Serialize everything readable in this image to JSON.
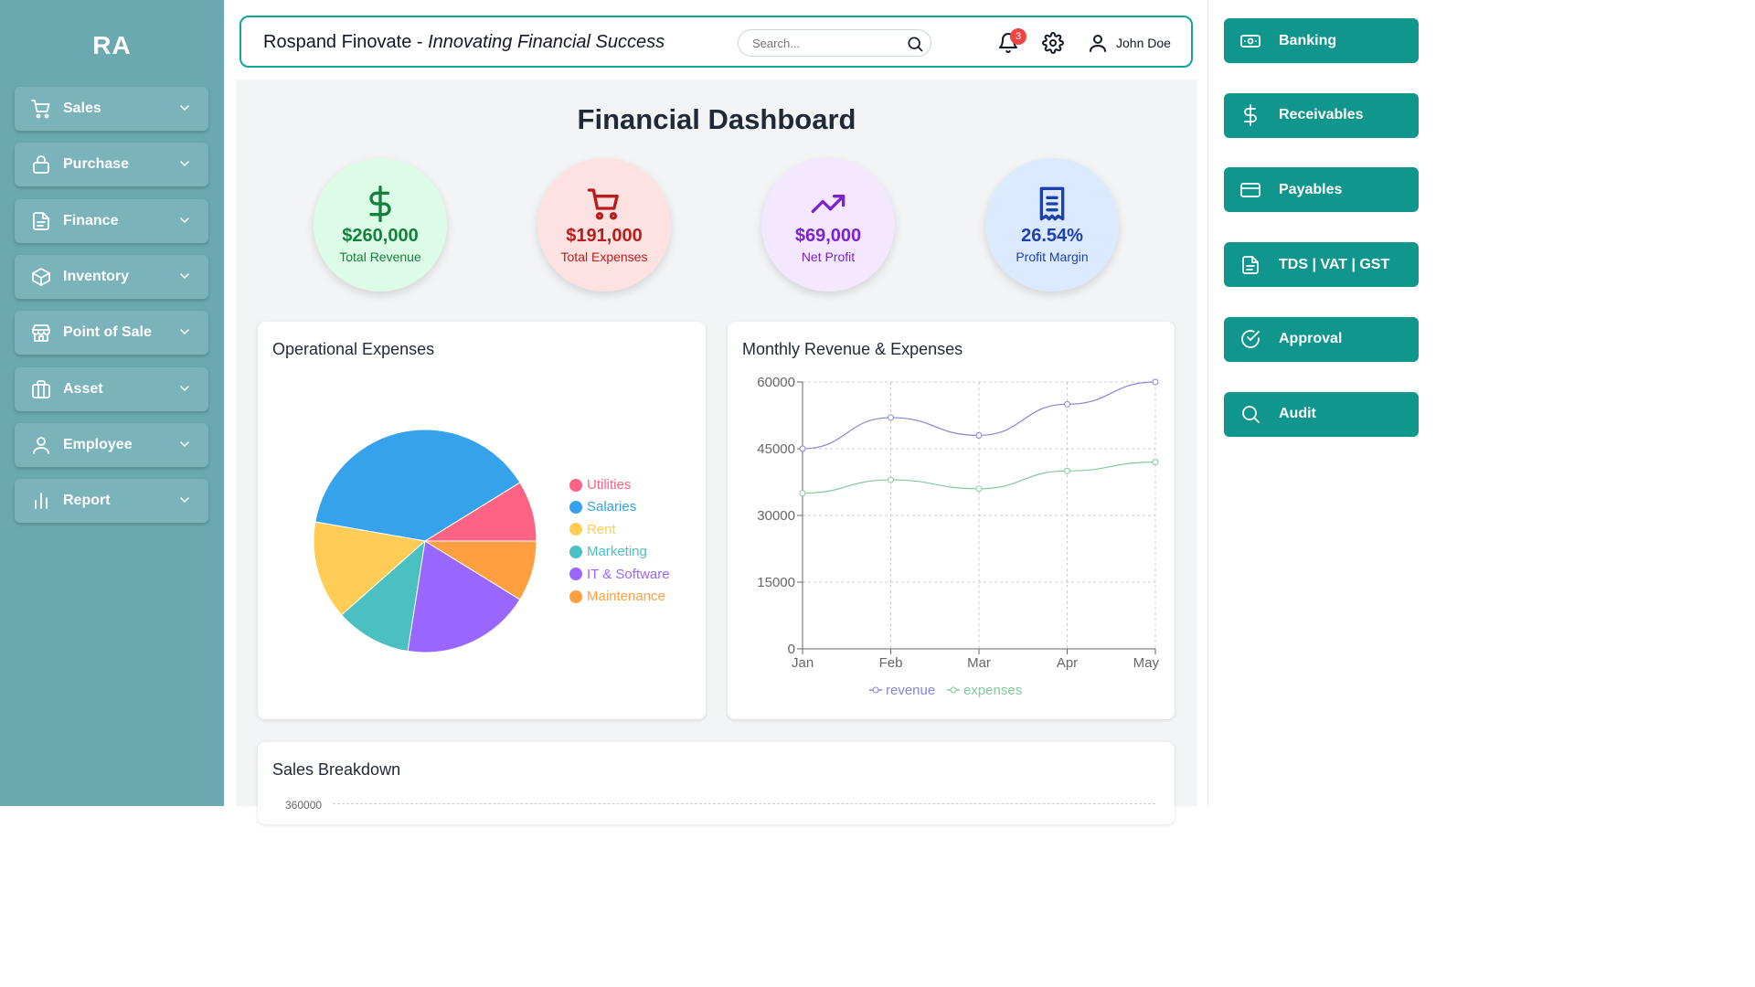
{
  "sidebar": {
    "logo": "RA",
    "items": [
      {
        "label": "Sales",
        "icon": "cart-icon"
      },
      {
        "label": "Purchase",
        "icon": "lock-icon"
      },
      {
        "label": "Finance",
        "icon": "document-icon"
      },
      {
        "label": "Inventory",
        "icon": "box-icon"
      },
      {
        "label": "Point of Sale",
        "icon": "store-icon"
      },
      {
        "label": "Asset",
        "icon": "briefcase-icon"
      },
      {
        "label": "Employee",
        "icon": "user-icon"
      },
      {
        "label": "Report",
        "icon": "bar-chart-icon"
      }
    ]
  },
  "header": {
    "company": "Rospand Finovate",
    "separator": " - ",
    "tagline": "Innovating Financial Success",
    "search_placeholder": "Search...",
    "notification_count": "3",
    "user_name": "John Doe"
  },
  "dashboard": {
    "title": "Financial Dashboard",
    "kpis": [
      {
        "value": "$260,000",
        "label": "Total Revenue",
        "icon": "dollar-icon",
        "bg": "#dcfce7",
        "color": "#15803d"
      },
      {
        "value": "$191,000",
        "label": "Total Expenses",
        "icon": "cart-icon",
        "bg": "#fee2e2",
        "color": "#b91c1c"
      },
      {
        "value": "$69,000",
        "label": "Net Profit",
        "icon": "trending-up-icon",
        "bg": "#f3e8ff",
        "color": "#7e22ce"
      },
      {
        "value": "26.54%",
        "label": "Profit Margin",
        "icon": "receipt-icon",
        "bg": "#dbeafe",
        "color": "#1e40af"
      }
    ],
    "operational_title": "Operational Expenses",
    "monthly_title": "Monthly Revenue & Expenses",
    "sales_title": "Sales Breakdown",
    "sales_partial_tick": "360000"
  },
  "rail": {
    "items": [
      {
        "label": "Banking",
        "icon": "banknote-icon"
      },
      {
        "label": "Receivables",
        "icon": "dollar-icon"
      },
      {
        "label": "Payables",
        "icon": "credit-card-icon"
      },
      {
        "label": "TDS | VAT | GST",
        "icon": "document-icon"
      },
      {
        "label": "Approval",
        "icon": "check-circle-icon"
      },
      {
        "label": "Audit",
        "icon": "search-icon"
      }
    ]
  },
  "chart_data": [
    {
      "type": "pie",
      "title": "Operational Expenses",
      "categories": [
        "Utilities",
        "Salaries",
        "Rent",
        "Marketing",
        "IT & Software",
        "Maintenance"
      ],
      "values": [
        8,
        35,
        13,
        10,
        17,
        8
      ],
      "colors": [
        "#ff6384",
        "#36a2eb",
        "#ffcd56",
        "#4bc0c0",
        "#9966ff",
        "#ff9f40"
      ],
      "legend": "right"
    },
    {
      "type": "line",
      "title": "Monthly Revenue & Expenses",
      "categories": [
        "Jan",
        "Feb",
        "Mar",
        "Apr",
        "May"
      ],
      "series": [
        {
          "name": "revenue",
          "values": [
            45000,
            52000,
            48000,
            55000,
            60000
          ],
          "color": "#8884d8"
        },
        {
          "name": "expenses",
          "values": [
            35000,
            38000,
            36000,
            40000,
            42000
          ],
          "color": "#82ca9d"
        }
      ],
      "yticks": [
        "0",
        "15000",
        "30000",
        "45000",
        "60000"
      ],
      "ylim": [
        0,
        60000
      ],
      "grid": true,
      "legend": "bottom"
    }
  ]
}
